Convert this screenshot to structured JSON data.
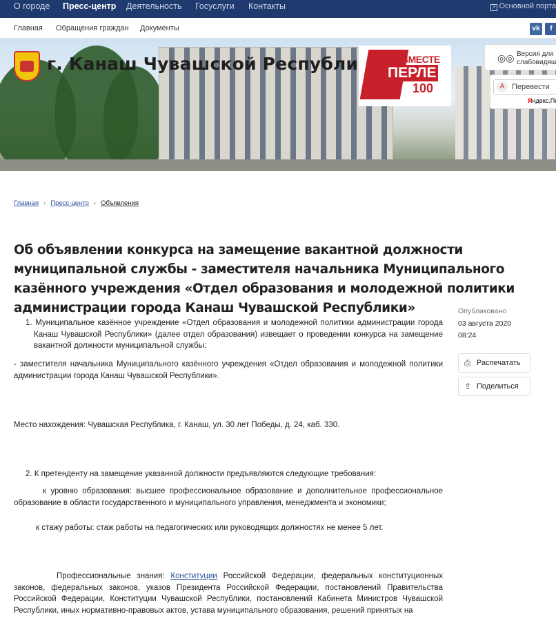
{
  "top_nav": {
    "items": [
      "О городе",
      "Пресс-центр",
      "Деятельность",
      "Госуслуги",
      "Контакты"
    ],
    "portal_link": "Основной порта"
  },
  "sub_nav": {
    "items": [
      "Главная",
      "Обращения граждан",
      "Документы"
    ],
    "social": [
      "vk",
      "f"
    ]
  },
  "banner": {
    "city_title": "г. Канаш Чувашской Республики",
    "promo": {
      "line1": "ВМЕСТЕ",
      "line2": "ПЕРЛЕ",
      "line3": "100"
    },
    "accessibility_label": "Версия для слабовидящ",
    "translate_button": "Перевести",
    "yandex_label_red": "Я",
    "yandex_label_rest": "ндекс.Пе"
  },
  "breadcrumb": [
    "Главная",
    "Пресс-центр",
    "Объявления"
  ],
  "article": {
    "title": "Об объявлении конкурса на замещение вакантной должности муниципальной службы - заместителя начальника Муниципального казённого учреждения «Отдел образования и молодежной политики администрации города Канаш Чувашской Республики»",
    "published_label": "Опубликовано",
    "published_date": "03 августа 2020",
    "published_time": "08:24",
    "print_button": "Распечатать",
    "share_button": "Поделиться",
    "p1": "1. Муниципальное казённое учреждение «Отдел образования и молодежной политики администрации города Канаш Чувашской Республики» (далее отдел образования) извещает о проведении конкурса на замещение вакантной должности муниципальной службы:",
    "p2": "- заместителя начальника Муниципального казённого учреждения «Отдел образования и молодежной политики администрации города Канаш Чувашской Республики».",
    "p3": "Место нахождения: Чувашская Республика, г. Канаш, ул. 30 лет Победы, д. 24, каб. 330.",
    "p4": "2. К претенденту на замещение указанной должности предъявляются следующие требования:",
    "p5": "к уровню образования: высшее профессиональное образование и дополнительное профессиональное образование в области государственного и муниципального управления, менеджмента и экономики;",
    "p6": "к стажу работы: стаж работы на педагогических или руководящих должностях не менее 5 лет.",
    "p7_before": "Профессиональные знания: ",
    "p7_link": "Конституции",
    "p7_after": " Российской Федерации, федеральных конституционных законов, федеральных законов, указов Президента Российской Федерации, постановлений Правительства Российской Федерации, Конституции Чувашской Республики, постановлений Кабинета Министров Чувашской Республики, иных нормативно-правовых актов, устава муниципального образования, решений принятых на"
  }
}
